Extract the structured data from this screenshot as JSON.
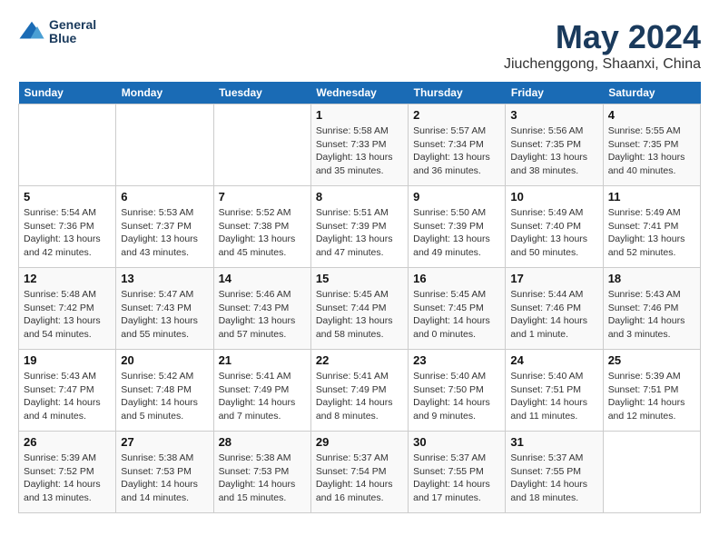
{
  "header": {
    "logo_line1": "General",
    "logo_line2": "Blue",
    "title": "May 2024",
    "subtitle": "Jiuchenggong, Shaanxi, China"
  },
  "weekdays": [
    "Sunday",
    "Monday",
    "Tuesday",
    "Wednesday",
    "Thursday",
    "Friday",
    "Saturday"
  ],
  "weeks": [
    [
      {
        "day": "",
        "info": ""
      },
      {
        "day": "",
        "info": ""
      },
      {
        "day": "",
        "info": ""
      },
      {
        "day": "1",
        "info": "Sunrise: 5:58 AM\nSunset: 7:33 PM\nDaylight: 13 hours\nand 35 minutes."
      },
      {
        "day": "2",
        "info": "Sunrise: 5:57 AM\nSunset: 7:34 PM\nDaylight: 13 hours\nand 36 minutes."
      },
      {
        "day": "3",
        "info": "Sunrise: 5:56 AM\nSunset: 7:35 PM\nDaylight: 13 hours\nand 38 minutes."
      },
      {
        "day": "4",
        "info": "Sunrise: 5:55 AM\nSunset: 7:35 PM\nDaylight: 13 hours\nand 40 minutes."
      }
    ],
    [
      {
        "day": "5",
        "info": "Sunrise: 5:54 AM\nSunset: 7:36 PM\nDaylight: 13 hours\nand 42 minutes."
      },
      {
        "day": "6",
        "info": "Sunrise: 5:53 AM\nSunset: 7:37 PM\nDaylight: 13 hours\nand 43 minutes."
      },
      {
        "day": "7",
        "info": "Sunrise: 5:52 AM\nSunset: 7:38 PM\nDaylight: 13 hours\nand 45 minutes."
      },
      {
        "day": "8",
        "info": "Sunrise: 5:51 AM\nSunset: 7:39 PM\nDaylight: 13 hours\nand 47 minutes."
      },
      {
        "day": "9",
        "info": "Sunrise: 5:50 AM\nSunset: 7:39 PM\nDaylight: 13 hours\nand 49 minutes."
      },
      {
        "day": "10",
        "info": "Sunrise: 5:49 AM\nSunset: 7:40 PM\nDaylight: 13 hours\nand 50 minutes."
      },
      {
        "day": "11",
        "info": "Sunrise: 5:49 AM\nSunset: 7:41 PM\nDaylight: 13 hours\nand 52 minutes."
      }
    ],
    [
      {
        "day": "12",
        "info": "Sunrise: 5:48 AM\nSunset: 7:42 PM\nDaylight: 13 hours\nand 54 minutes."
      },
      {
        "day": "13",
        "info": "Sunrise: 5:47 AM\nSunset: 7:43 PM\nDaylight: 13 hours\nand 55 minutes."
      },
      {
        "day": "14",
        "info": "Sunrise: 5:46 AM\nSunset: 7:43 PM\nDaylight: 13 hours\nand 57 minutes."
      },
      {
        "day": "15",
        "info": "Sunrise: 5:45 AM\nSunset: 7:44 PM\nDaylight: 13 hours\nand 58 minutes."
      },
      {
        "day": "16",
        "info": "Sunrise: 5:45 AM\nSunset: 7:45 PM\nDaylight: 14 hours\nand 0 minutes."
      },
      {
        "day": "17",
        "info": "Sunrise: 5:44 AM\nSunset: 7:46 PM\nDaylight: 14 hours\nand 1 minute."
      },
      {
        "day": "18",
        "info": "Sunrise: 5:43 AM\nSunset: 7:46 PM\nDaylight: 14 hours\nand 3 minutes."
      }
    ],
    [
      {
        "day": "19",
        "info": "Sunrise: 5:43 AM\nSunset: 7:47 PM\nDaylight: 14 hours\nand 4 minutes."
      },
      {
        "day": "20",
        "info": "Sunrise: 5:42 AM\nSunset: 7:48 PM\nDaylight: 14 hours\nand 5 minutes."
      },
      {
        "day": "21",
        "info": "Sunrise: 5:41 AM\nSunset: 7:49 PM\nDaylight: 14 hours\nand 7 minutes."
      },
      {
        "day": "22",
        "info": "Sunrise: 5:41 AM\nSunset: 7:49 PM\nDaylight: 14 hours\nand 8 minutes."
      },
      {
        "day": "23",
        "info": "Sunrise: 5:40 AM\nSunset: 7:50 PM\nDaylight: 14 hours\nand 9 minutes."
      },
      {
        "day": "24",
        "info": "Sunrise: 5:40 AM\nSunset: 7:51 PM\nDaylight: 14 hours\nand 11 minutes."
      },
      {
        "day": "25",
        "info": "Sunrise: 5:39 AM\nSunset: 7:51 PM\nDaylight: 14 hours\nand 12 minutes."
      }
    ],
    [
      {
        "day": "26",
        "info": "Sunrise: 5:39 AM\nSunset: 7:52 PM\nDaylight: 14 hours\nand 13 minutes."
      },
      {
        "day": "27",
        "info": "Sunrise: 5:38 AM\nSunset: 7:53 PM\nDaylight: 14 hours\nand 14 minutes."
      },
      {
        "day": "28",
        "info": "Sunrise: 5:38 AM\nSunset: 7:53 PM\nDaylight: 14 hours\nand 15 minutes."
      },
      {
        "day": "29",
        "info": "Sunrise: 5:37 AM\nSunset: 7:54 PM\nDaylight: 14 hours\nand 16 minutes."
      },
      {
        "day": "30",
        "info": "Sunrise: 5:37 AM\nSunset: 7:55 PM\nDaylight: 14 hours\nand 17 minutes."
      },
      {
        "day": "31",
        "info": "Sunrise: 5:37 AM\nSunset: 7:55 PM\nDaylight: 14 hours\nand 18 minutes."
      },
      {
        "day": "",
        "info": ""
      }
    ]
  ]
}
